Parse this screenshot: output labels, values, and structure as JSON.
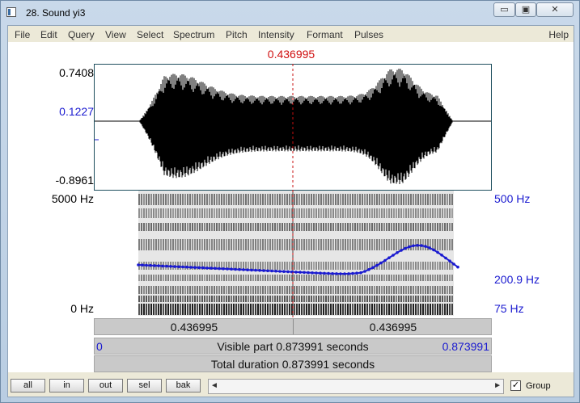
{
  "window": {
    "title": "28. Sound yi3",
    "min_glyph": "▭",
    "max_glyph": "▣",
    "close_glyph": "✕"
  },
  "menu": {
    "items": [
      "File",
      "Edit",
      "Query",
      "View",
      "Select",
      "Spectrum",
      "Pitch",
      "Intensity",
      "Formant",
      "Pulses"
    ],
    "help": "Help"
  },
  "cursor": {
    "time": "0.436995"
  },
  "waveform": {
    "top_value": "0.7408",
    "cursor_value": "0.1227",
    "bottom_value": "-0.8961",
    "color_fill": "#000000"
  },
  "spectrogram": {
    "top_freq": "5000 Hz",
    "bottom_freq": "0 Hz",
    "pitch_top": "500 Hz",
    "pitch_cursor": "200.9 Hz",
    "pitch_bottom": "75 Hz",
    "pitch_color": "#1a1ad0"
  },
  "time_rows": {
    "left_segment": "0.436995",
    "right_segment": "0.436995",
    "visible_start": "0",
    "visible_label": "Visible part 0.873991 seconds",
    "visible_end": "0.873991",
    "total_label": "Total duration 0.873991 seconds"
  },
  "toolbar": {
    "all": "all",
    "in": "in",
    "out": "out",
    "sel": "sel",
    "bak": "bak",
    "group_label": "Group",
    "group_checked": "✓",
    "scroll_left": "◄",
    "scroll_right": "►"
  }
}
